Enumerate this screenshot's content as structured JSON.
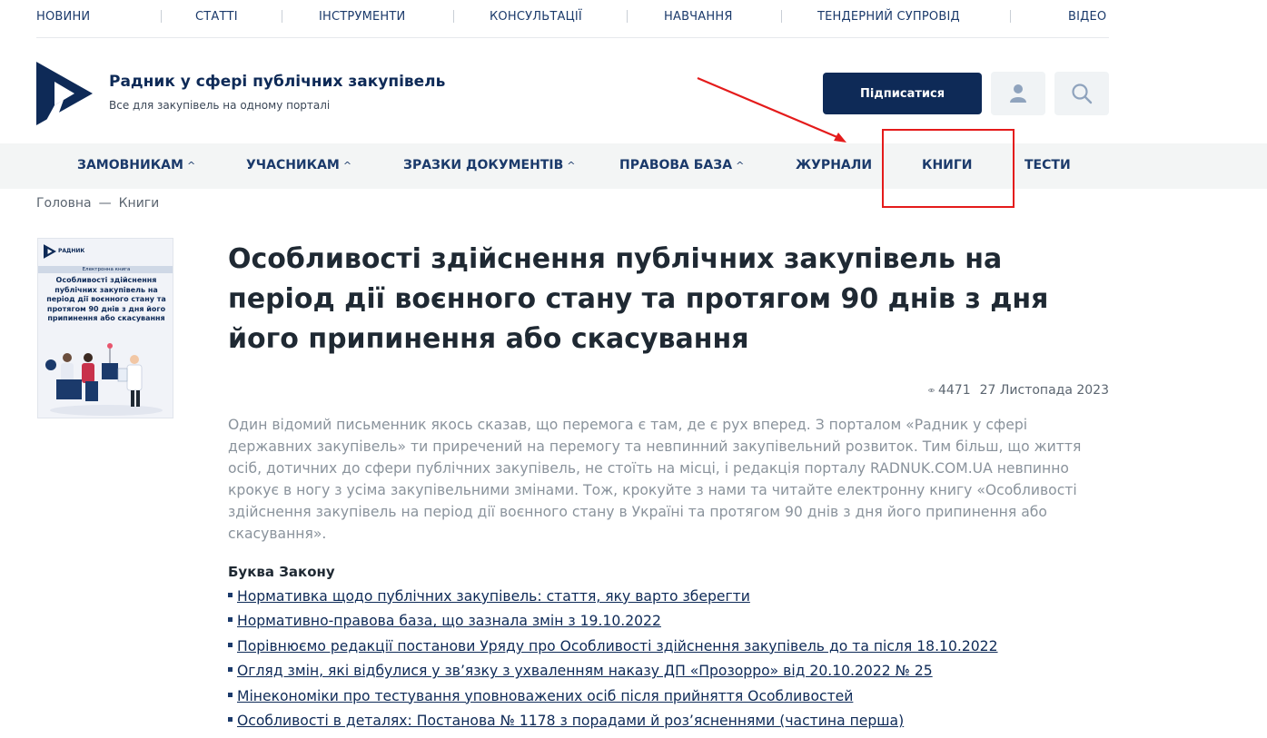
{
  "topnav": {
    "items": [
      "НОВИНИ",
      "СТАТТІ",
      "ІНСТРУМЕНТИ",
      "КОНСУЛЬТАЦІЇ",
      "НАВЧАННЯ",
      "ТЕНДЕРНИЙ СУПРОВІД",
      "ВІДЕО"
    ]
  },
  "header": {
    "title": "Радник у сфері публічних закупівель",
    "subtitle": "Все для закупівель на одному порталі",
    "subscribe_label": "Підписатися"
  },
  "mainmenu": {
    "items": [
      "ЗАМОВНИКАМ",
      "УЧАСНИКАМ",
      "ЗРАЗКИ ДОКУМЕНТІВ",
      "ПРАВОВА БАЗА",
      "ЖУРНАЛИ",
      "КНИГИ",
      "ТЕСТИ"
    ],
    "chevron": "^"
  },
  "breadcrumb": {
    "home": "Головна",
    "separator": "—",
    "current": "Книги"
  },
  "cover": {
    "brand": "РАДНИК",
    "band": "Електронна книга",
    "title": "Особливості здійснення публічних закупівель на період дії воєнного стану та протягом 90 днів з дня його припинення або скасування"
  },
  "article": {
    "title": "Особливості здійснення публічних закупівель на період дії воєнного стану та протягом 90 днів з дня його припинення або скасування",
    "views": "4471",
    "date": "27 Листопада 2023",
    "lead": "Один відомий письменник якось сказав, що перемога є там, де є рух вперед. З порталом «Радник у сфері державних закупівель» ти приречений на перемогу та невпинний закупівельний розвиток. Тим більш, що життя осіб, дотичних до сфери публічних закупівель, не стоїть на місці, і редакція порталу RADNUK.COM.UA невпинно крокує в ногу з усіма закупівельними змінами. Тож, крокуйте з нами та читайте електронну книгу «Особливості здійснення закупівель на період дії воєнного стану в Україні та протягом 90 днів з дня його припинення або скасування».",
    "section_title": "Буква Закону",
    "links": [
      "Нормативка щодо публічних закупівель: стаття, яку варто зберегти",
      "Нормативно-правова база, що зазнала змін з 19.10.2022",
      "Порівнюємо редакції постанови Уряду про Особливості здійснення закупівель до та після 18.10.2022",
      "Огляд змін, які відбулися у зв’язку з ухваленням наказу ДП «Прозорро» від 20.10.2022 № 25",
      "Мінекономіки про тестування уповноважених осіб після прийняття Особливостей",
      "Особливості в деталях: Постанова № 1178 з порадами й роз’ясненнями (частина перша)"
    ]
  },
  "colors": {
    "brand_dark": "#0e2a57",
    "menu_bg": "#f3f5f5",
    "annotation_red": "#e41b1b",
    "lead_text": "#8a939c"
  }
}
